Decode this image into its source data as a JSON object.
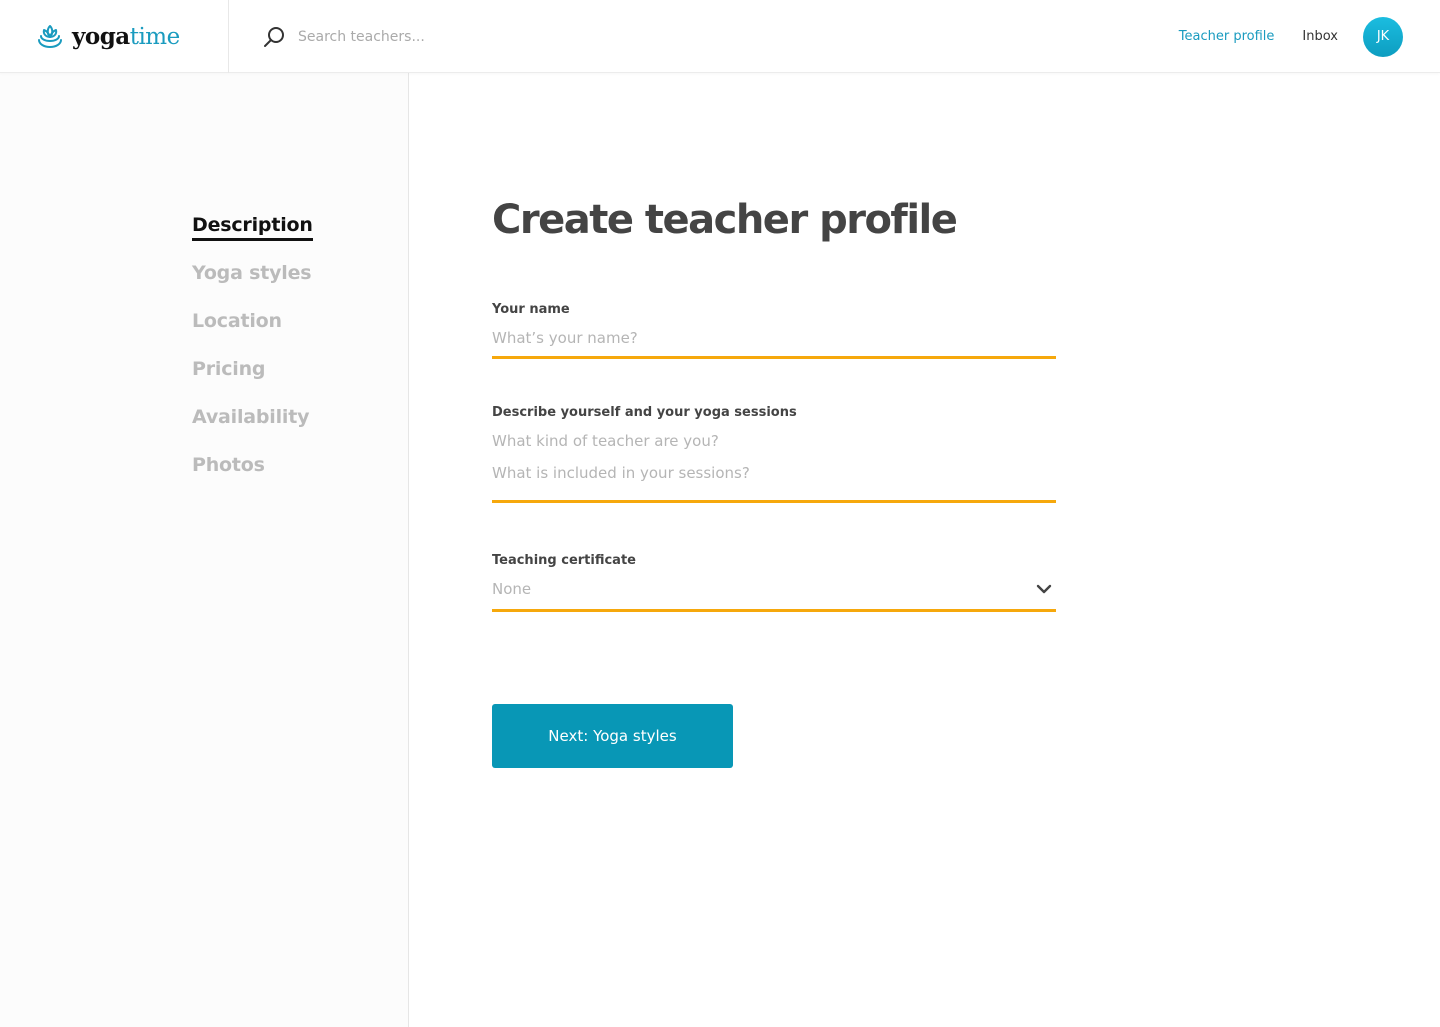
{
  "header": {
    "logo": {
      "part1": "yoga",
      "part2": "time",
      "icon": "lotus-icon"
    },
    "search": {
      "placeholder": "Search teachers...",
      "value": "",
      "icon": "search-icon"
    },
    "nav": [
      {
        "label": "Teacher profile",
        "active": true
      },
      {
        "label": "Inbox",
        "active": false
      }
    ],
    "avatar": {
      "initials": "JK"
    }
  },
  "sidebar": {
    "steps": [
      {
        "label": "Description",
        "active": true
      },
      {
        "label": "Yoga styles",
        "active": false
      },
      {
        "label": "Location",
        "active": false
      },
      {
        "label": "Pricing",
        "active": false
      },
      {
        "label": "Availability",
        "active": false
      },
      {
        "label": "Photos",
        "active": false
      }
    ]
  },
  "main": {
    "title": "Create teacher profile",
    "fields": {
      "name": {
        "label": "Your name",
        "placeholder": "What’s your name?",
        "value": ""
      },
      "description": {
        "label": "Describe yourself and your yoga sessions",
        "placeholder": "What kind of teacher are you?\nWhat is included in your sessions?",
        "value": ""
      },
      "certificate": {
        "label": "Teaching certificate",
        "selected": "None",
        "icon": "chevron-down-icon"
      }
    },
    "next_button": "Next: Yoga styles"
  },
  "colors": {
    "accent": "#1a9bbf",
    "button": "#0897b6",
    "underline": "#f6a80c",
    "active_step": "#111111",
    "inactive_step": "#bbbbbb"
  }
}
